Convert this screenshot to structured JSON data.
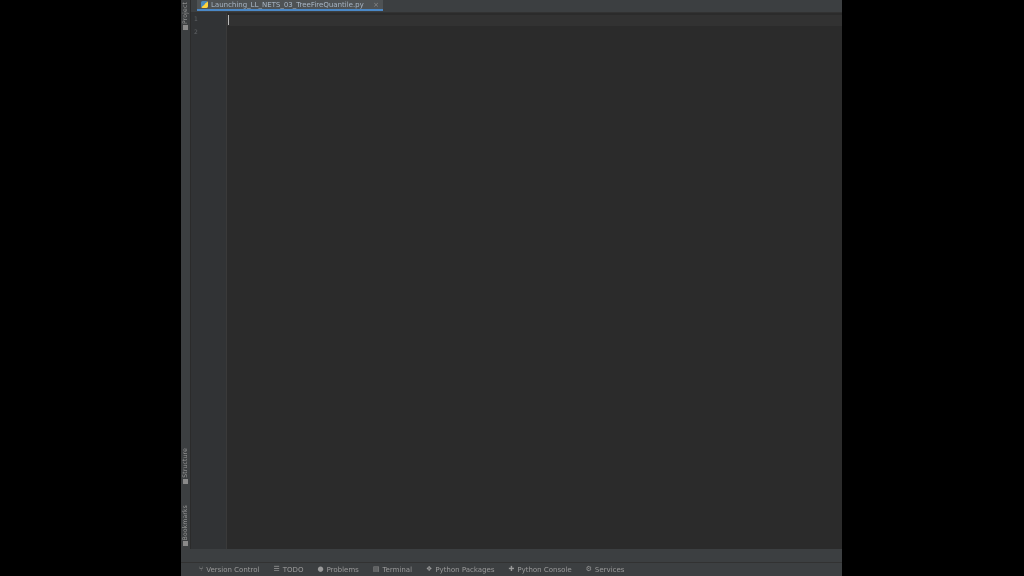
{
  "tab": {
    "filename": "Launching_LL_NETS_03_TreeFireQuantile.py",
    "file_icon": "python-file-icon",
    "close_glyph": "×"
  },
  "left_tools": {
    "project": "Project",
    "structure": "Structure",
    "bookmarks": "Bookmarks"
  },
  "editor": {
    "line_numbers": [
      "1",
      "2"
    ]
  },
  "bottom_tools": [
    {
      "icon": "branch-icon",
      "glyph": "⑂",
      "label": "Version Control"
    },
    {
      "icon": "todo-icon",
      "glyph": "☰",
      "label": "TODO"
    },
    {
      "icon": "problems-icon",
      "glyph": "●",
      "label": "Problems"
    },
    {
      "icon": "terminal-icon",
      "glyph": "▤",
      "label": "Terminal"
    },
    {
      "icon": "packages-icon",
      "glyph": "❖",
      "label": "Python Packages"
    },
    {
      "icon": "console-icon",
      "glyph": "✚",
      "label": "Python Console"
    },
    {
      "icon": "services-icon",
      "glyph": "⚙",
      "label": "Services"
    }
  ],
  "colors": {
    "editor_bg": "#2b2b2b",
    "panel_bg": "#3c3f41",
    "accent": "#4a88c7"
  }
}
